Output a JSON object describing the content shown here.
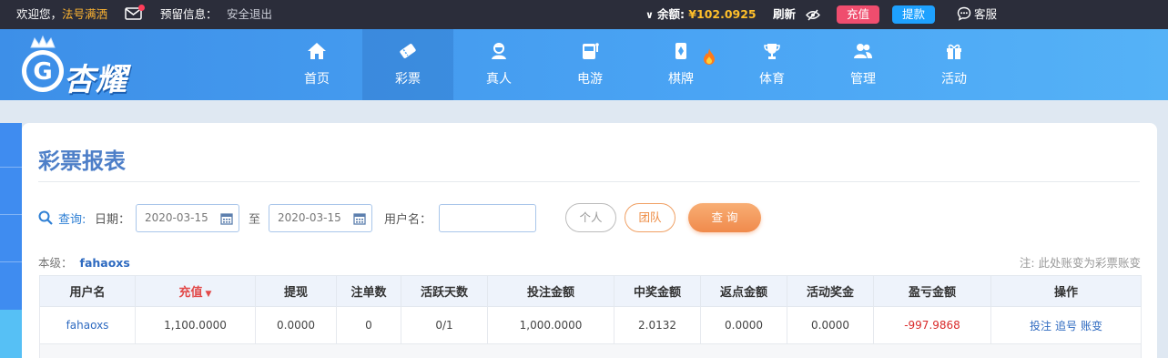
{
  "topbar": {
    "welcome": "欢迎您，",
    "username": "法号满洒",
    "notice_label": "预留信息：",
    "logout": "安全退出",
    "balance_label": "余额:",
    "balance": "¥102.0925",
    "refresh": "刷新",
    "recharge": "充值",
    "withdraw": "提款",
    "service": "客服"
  },
  "logo": {
    "text": "杏耀"
  },
  "nav": [
    {
      "label": "首页",
      "icon": "home-icon"
    },
    {
      "label": "彩票",
      "icon": "ticket-icon",
      "active": true
    },
    {
      "label": "真人",
      "icon": "dealer-icon"
    },
    {
      "label": "电游",
      "icon": "slot-machine-icon"
    },
    {
      "label": "棋牌",
      "icon": "cards-icon",
      "hot": true
    },
    {
      "label": "体育",
      "icon": "trophy-icon"
    },
    {
      "label": "管理",
      "icon": "users-icon"
    },
    {
      "label": "活动",
      "icon": "gift-icon"
    }
  ],
  "page": {
    "title": "彩票报表",
    "query_label": "查询:",
    "date_label": "日期：",
    "start_date": "2020-03-15",
    "to": "至",
    "end_date": "2020-03-15",
    "username_label": "用户名：",
    "username_value": "",
    "btn_personal": "个人",
    "btn_team": "团队",
    "btn_query": "查 询",
    "level_label": "本级：",
    "level_user": "fahaoxs",
    "note": "注: 此处账变为彩票账变"
  },
  "table": {
    "headers": [
      "用户名",
      "充值",
      "提现",
      "注单数",
      "活跃天数",
      "投注金额",
      "中奖金额",
      "返点金额",
      "活动奖金",
      "盈亏金额",
      "操作"
    ],
    "sort_column": 1,
    "row": {
      "user": "fahaoxs",
      "recharge": "1,100.0000",
      "withdraw": "0.0000",
      "orders": "0",
      "active_days": "0/1",
      "bet": "1,000.0000",
      "win": "2.0132",
      "rebate": "0.0000",
      "bonus": "0.0000",
      "profit": "-997.9868",
      "op_bet": "投注",
      "op_chase": "追号",
      "op_change": "账变"
    }
  },
  "colors": {
    "accent": "#4aa4f4",
    "recharge_btn": "#ef4d6e",
    "withdraw_btn": "#1ea1ff",
    "loss": "#d92b2b",
    "query_btn": "#f08a4c"
  }
}
